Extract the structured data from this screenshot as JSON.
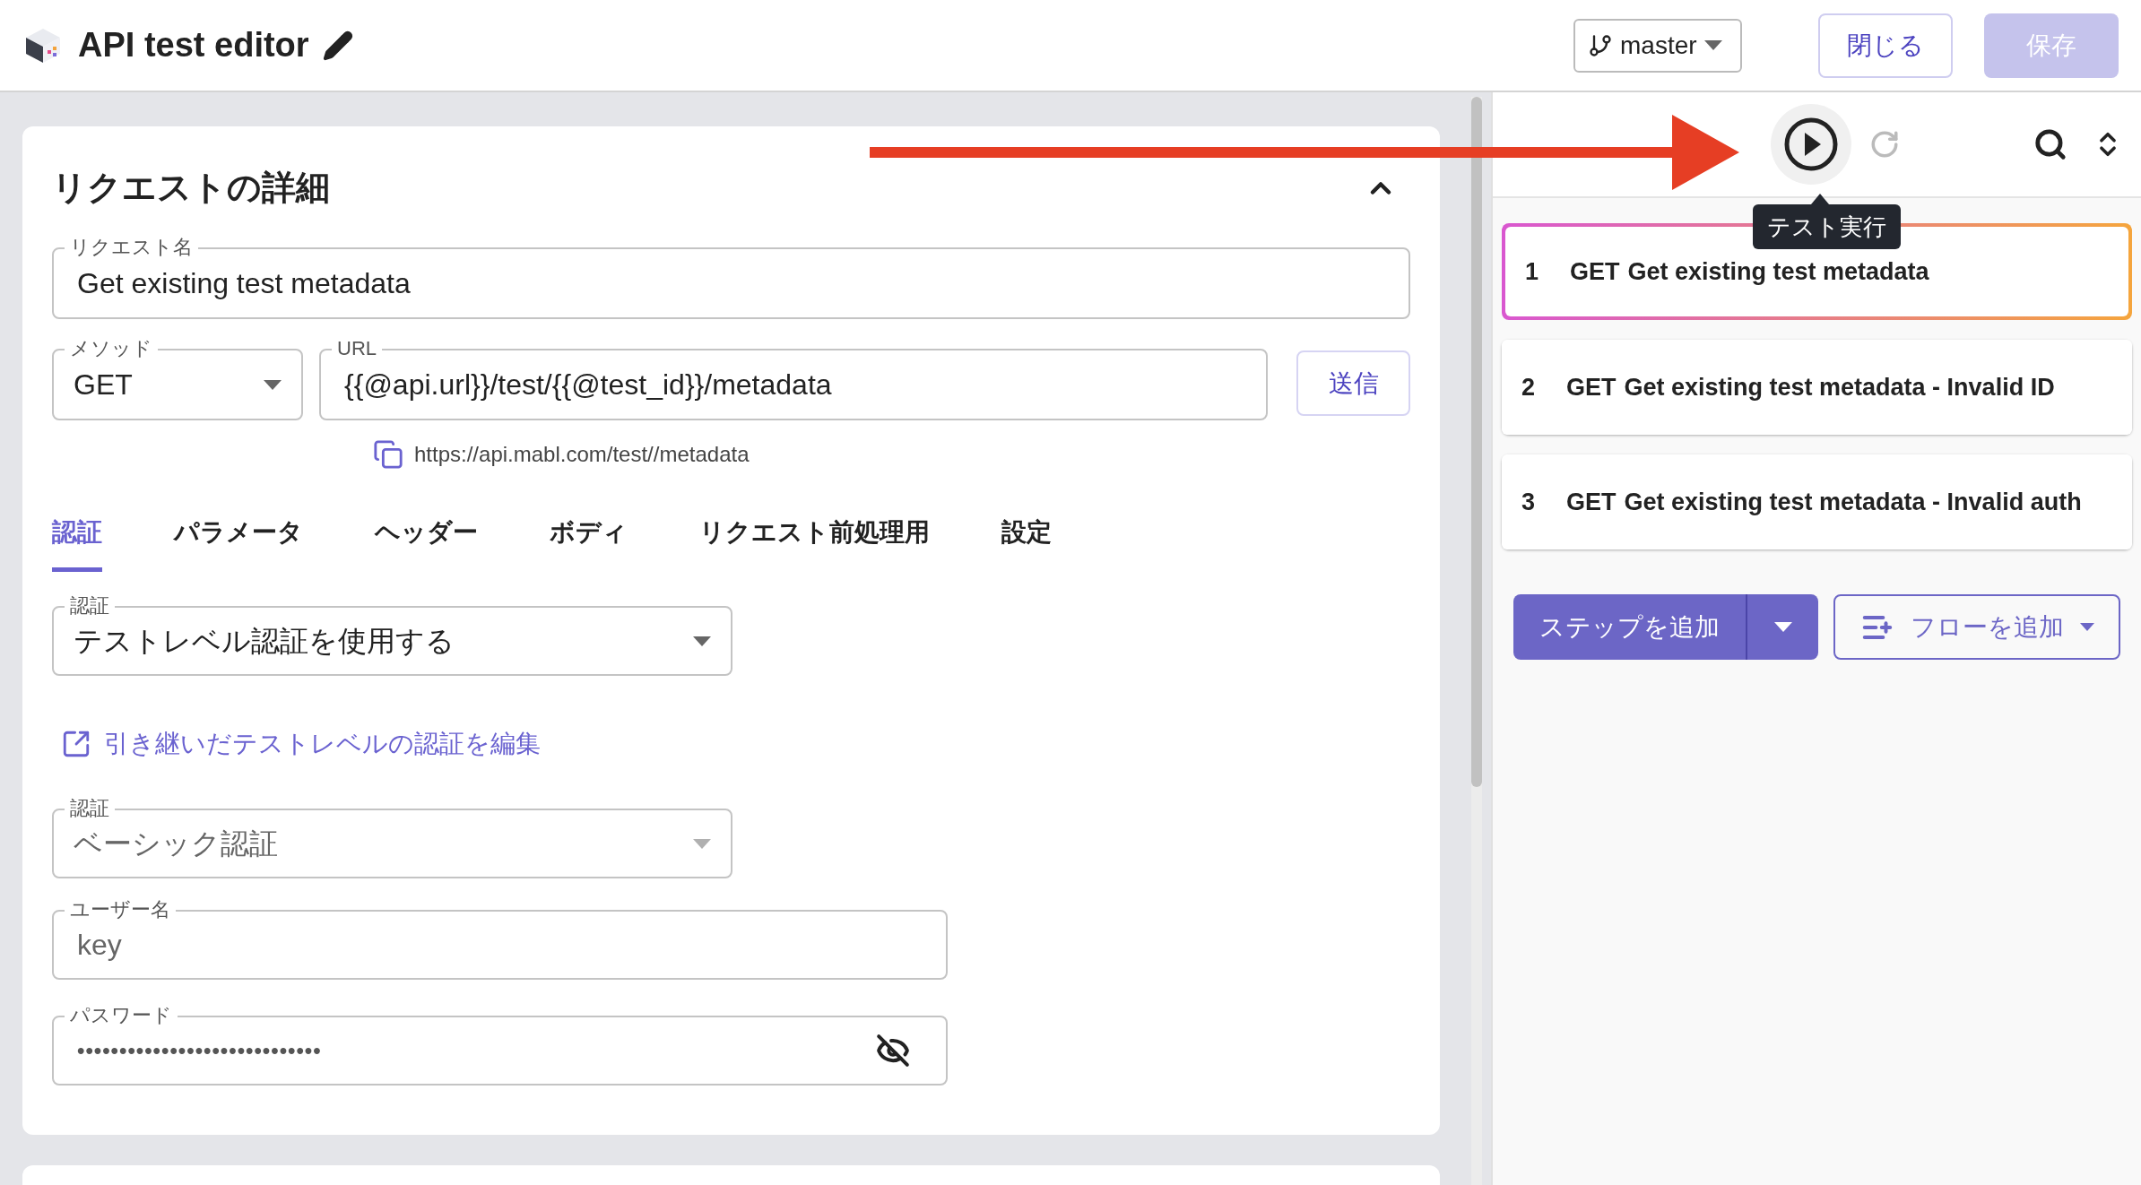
{
  "header": {
    "title": "API test editor",
    "branch": "master",
    "buttons": [
      {
        "label": "閉じる",
        "disabled": false
      },
      {
        "label": "保存",
        "disabled": true
      }
    ]
  },
  "request": {
    "title": "リクエストの詳細",
    "expanded": true,
    "name_field": {
      "label": "リクエスト名",
      "value": "Get existing test metadata"
    },
    "method": {
      "label": "メソッド",
      "value": "GET"
    },
    "url": {
      "label": "URL",
      "value": "{{@api.url}}/test/{{@test_id}}/metadata"
    },
    "send_button": "送信",
    "resolved_url": "https://api.mabl.com/test//metadata",
    "tabs": [
      {
        "label": "認証",
        "selected": true
      },
      {
        "label": "パラメータ",
        "selected": false
      },
      {
        "label": "ヘッダー",
        "selected": false
      },
      {
        "label": "ボディ",
        "selected": false
      },
      {
        "label": "リクエスト前処理用",
        "selected": false
      },
      {
        "label": "設定",
        "selected": false
      }
    ],
    "auth_select": {
      "label": "認証",
      "value": "テストレベル認証を使用する",
      "disabled": false
    },
    "edit_link": "引き継いだテストレベルの認証を編集",
    "auth_type": {
      "label": "認証",
      "value": "ベーシック認証",
      "disabled": true
    },
    "username": {
      "label": "ユーザー名",
      "value": "key",
      "disabled": true
    },
    "password": {
      "label": "パスワード",
      "value": "•••••••••••••••••••••••••••••",
      "disabled": true
    }
  },
  "steps_panel": {
    "tooltip": "テスト実行",
    "steps": [
      {
        "number": "1",
        "method": "GET",
        "name": "Get existing test metadata",
        "selected": true
      },
      {
        "number": "2",
        "method": "GET",
        "name": "Get existing test metadata - Invalid ID",
        "selected": false
      },
      {
        "number": "3",
        "method": "GET",
        "name": "Get existing test metadata - Invalid auth",
        "selected": false
      }
    ],
    "add_step_button": "ステップを追加",
    "add_flow_button": "フローを追加"
  }
}
